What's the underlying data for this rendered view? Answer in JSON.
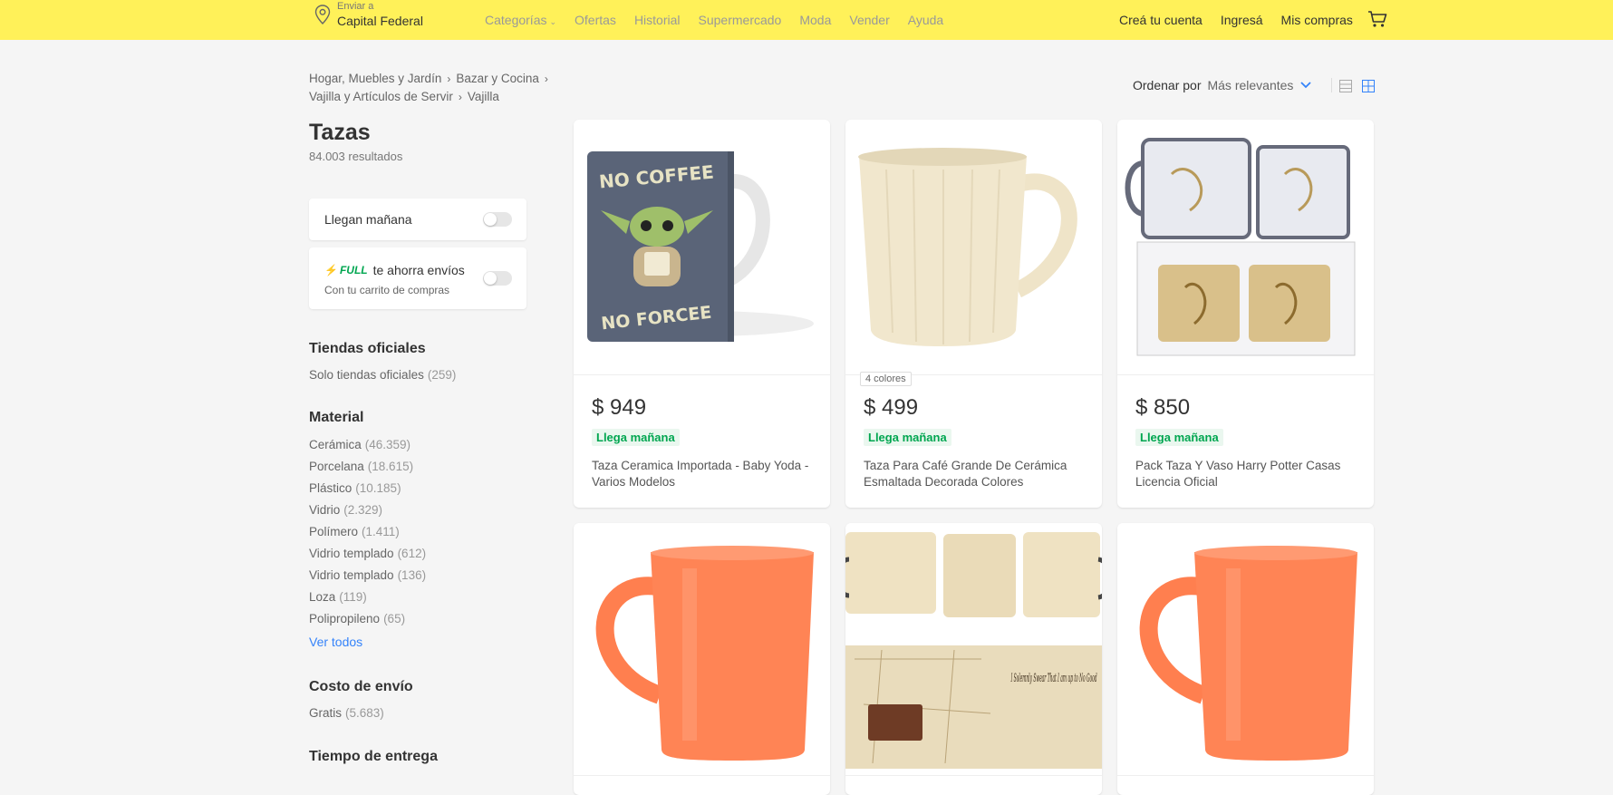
{
  "header": {
    "location_small": "Enviar a",
    "location_big": "Capital Federal",
    "nav": [
      "Categorías",
      "Ofertas",
      "Historial",
      "Supermercado",
      "Moda",
      "Vender",
      "Ayuda"
    ],
    "account": [
      "Creá tu cuenta",
      "Ingresá",
      "Mis compras"
    ],
    "colors": {
      "bar": "#fff159"
    }
  },
  "breadcrumb": {
    "items": [
      "Hogar, Muebles y Jardín",
      "Bazar y Cocina",
      "Vajilla y Artículos de Servir",
      "Vajilla"
    ]
  },
  "sort": {
    "label": "Ordenar por",
    "value": "Más relevantes"
  },
  "page": {
    "title": "Tazas",
    "results": "84.003 resultados"
  },
  "filters": {
    "tomorrow_label": "Llegan mañana",
    "full_badge": "FULL",
    "full_label": "te ahorra envíos",
    "full_sub": "Con tu carrito de compras",
    "official": {
      "heading": "Tiendas oficiales",
      "item": "Solo tiendas oficiales",
      "count": "(259)"
    },
    "material": {
      "heading": "Material",
      "items": [
        {
          "name": "Cerámica",
          "count": "(46.359)"
        },
        {
          "name": "Porcelana",
          "count": "(18.615)"
        },
        {
          "name": "Plástico",
          "count": "(10.185)"
        },
        {
          "name": "Vidrio",
          "count": "(2.329)"
        },
        {
          "name": "Polímero",
          "count": "(1.411)"
        },
        {
          "name": "Vidrio templado",
          "count": "(612)"
        },
        {
          "name": "Vidrio templado",
          "count": "(136)"
        },
        {
          "name": "Loza",
          "count": "(119)"
        },
        {
          "name": "Polipropileno",
          "count": "(65)"
        }
      ],
      "see_all": "Ver todos"
    },
    "shipping": {
      "heading": "Costo de envío",
      "item": "Gratis",
      "count": "(5.683)"
    },
    "delivery": {
      "heading": "Tiempo de entrega"
    }
  },
  "products": [
    {
      "price": "$ 949",
      "badge": "Llega mañana",
      "title": "Taza Ceramica Importada - Baby Yoda - Varios Modelos",
      "image": "baby-yoda-mug"
    },
    {
      "price": "$ 499",
      "badge": "Llega mañana",
      "title": "Taza Para Café Grande De Cerámica Esmaltada Decorada Colores",
      "colors": "4 colores",
      "image": "cream-mug"
    },
    {
      "price": "$ 850",
      "badge": "Llega mañana",
      "title": "Pack Taza Y Vaso Harry Potter Casas Licencia Oficial",
      "image": "glass-mug-pack"
    },
    {
      "image": "orange-mug"
    },
    {
      "image": "marauders-map-mug"
    },
    {
      "image": "orange-mug"
    }
  ],
  "mug_art": {
    "yoda_top": "NO COFFEE",
    "yoda_bottom": "NO FORCEE",
    "map_text": "I Solemnly Swear That I am up to No Good"
  }
}
